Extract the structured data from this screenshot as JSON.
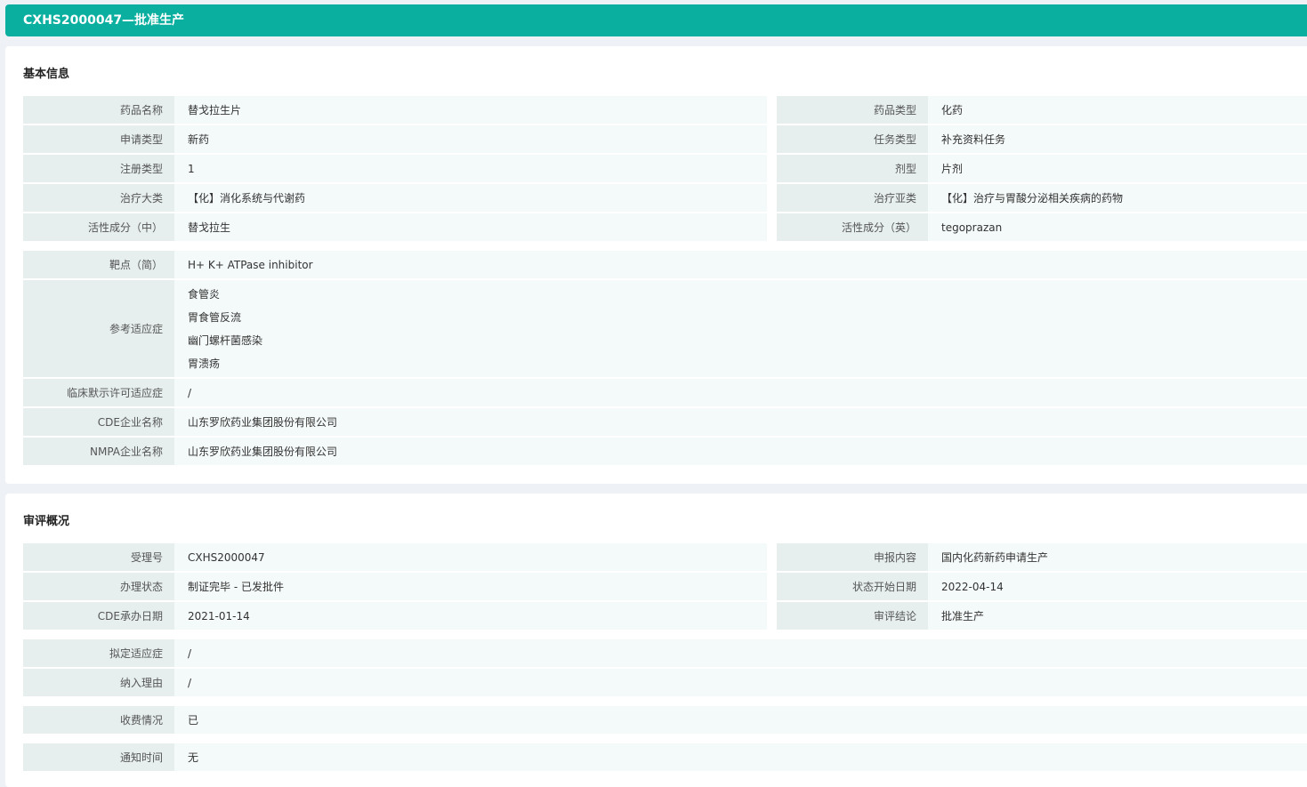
{
  "header": {
    "title": "CXHS2000047—批准生产"
  },
  "basic": {
    "title": "基本信息",
    "left": [
      {
        "label": "药品名称",
        "value": "替戈拉生片"
      },
      {
        "label": "申请类型",
        "value": "新药"
      },
      {
        "label": "注册类型",
        "value": "1"
      },
      {
        "label": "治疗大类",
        "value": "【化】消化系统与代谢药"
      },
      {
        "label": "活性成分（中）",
        "value": "替戈拉生"
      }
    ],
    "right": [
      {
        "label": "药品类型",
        "value": "化药"
      },
      {
        "label": "任务类型",
        "value": "补充资料任务"
      },
      {
        "label": "剂型",
        "value": "片剂"
      },
      {
        "label": "治疗亚类",
        "value": "【化】治疗与胃酸分泌相关疾病的药物"
      },
      {
        "label": "活性成分（英）",
        "value": "tegoprazan"
      }
    ],
    "target": {
      "label": "靶点（简）",
      "value": "H+ K+ ATPase inhibitor"
    },
    "indications": {
      "label": "参考适应症",
      "values": [
        "食管炎",
        "胃食管反流",
        "幽门螺杆菌感染",
        "胃溃疡"
      ]
    },
    "clinical": {
      "label": "临床默示许可适应症",
      "value": "/"
    },
    "cde_company": {
      "label": "CDE企业名称",
      "value": "山东罗欣药业集团股份有限公司"
    },
    "nmpa_company": {
      "label": "NMPA企业名称",
      "value": "山东罗欣药业集团股份有限公司"
    }
  },
  "review": {
    "title": "审评概况",
    "left": [
      {
        "label": "受理号",
        "value": "CXHS2000047"
      },
      {
        "label": "办理状态",
        "value": "制证完毕 - 已发批件"
      },
      {
        "label": "CDE承办日期",
        "value": "2021-01-14"
      }
    ],
    "right": [
      {
        "label": "申报内容",
        "value": "国内化药新药申请生产"
      },
      {
        "label": "状态开始日期",
        "value": "2022-04-14"
      },
      {
        "label": "审评结论",
        "value": "批准生产"
      }
    ],
    "proposed": {
      "label": "拟定适应症",
      "value": "/"
    },
    "reason": {
      "label": "纳入理由",
      "value": "/"
    },
    "fee": {
      "label": "收费情况",
      "value": "已"
    },
    "notice": {
      "label": "通知时间",
      "value": "无"
    }
  }
}
